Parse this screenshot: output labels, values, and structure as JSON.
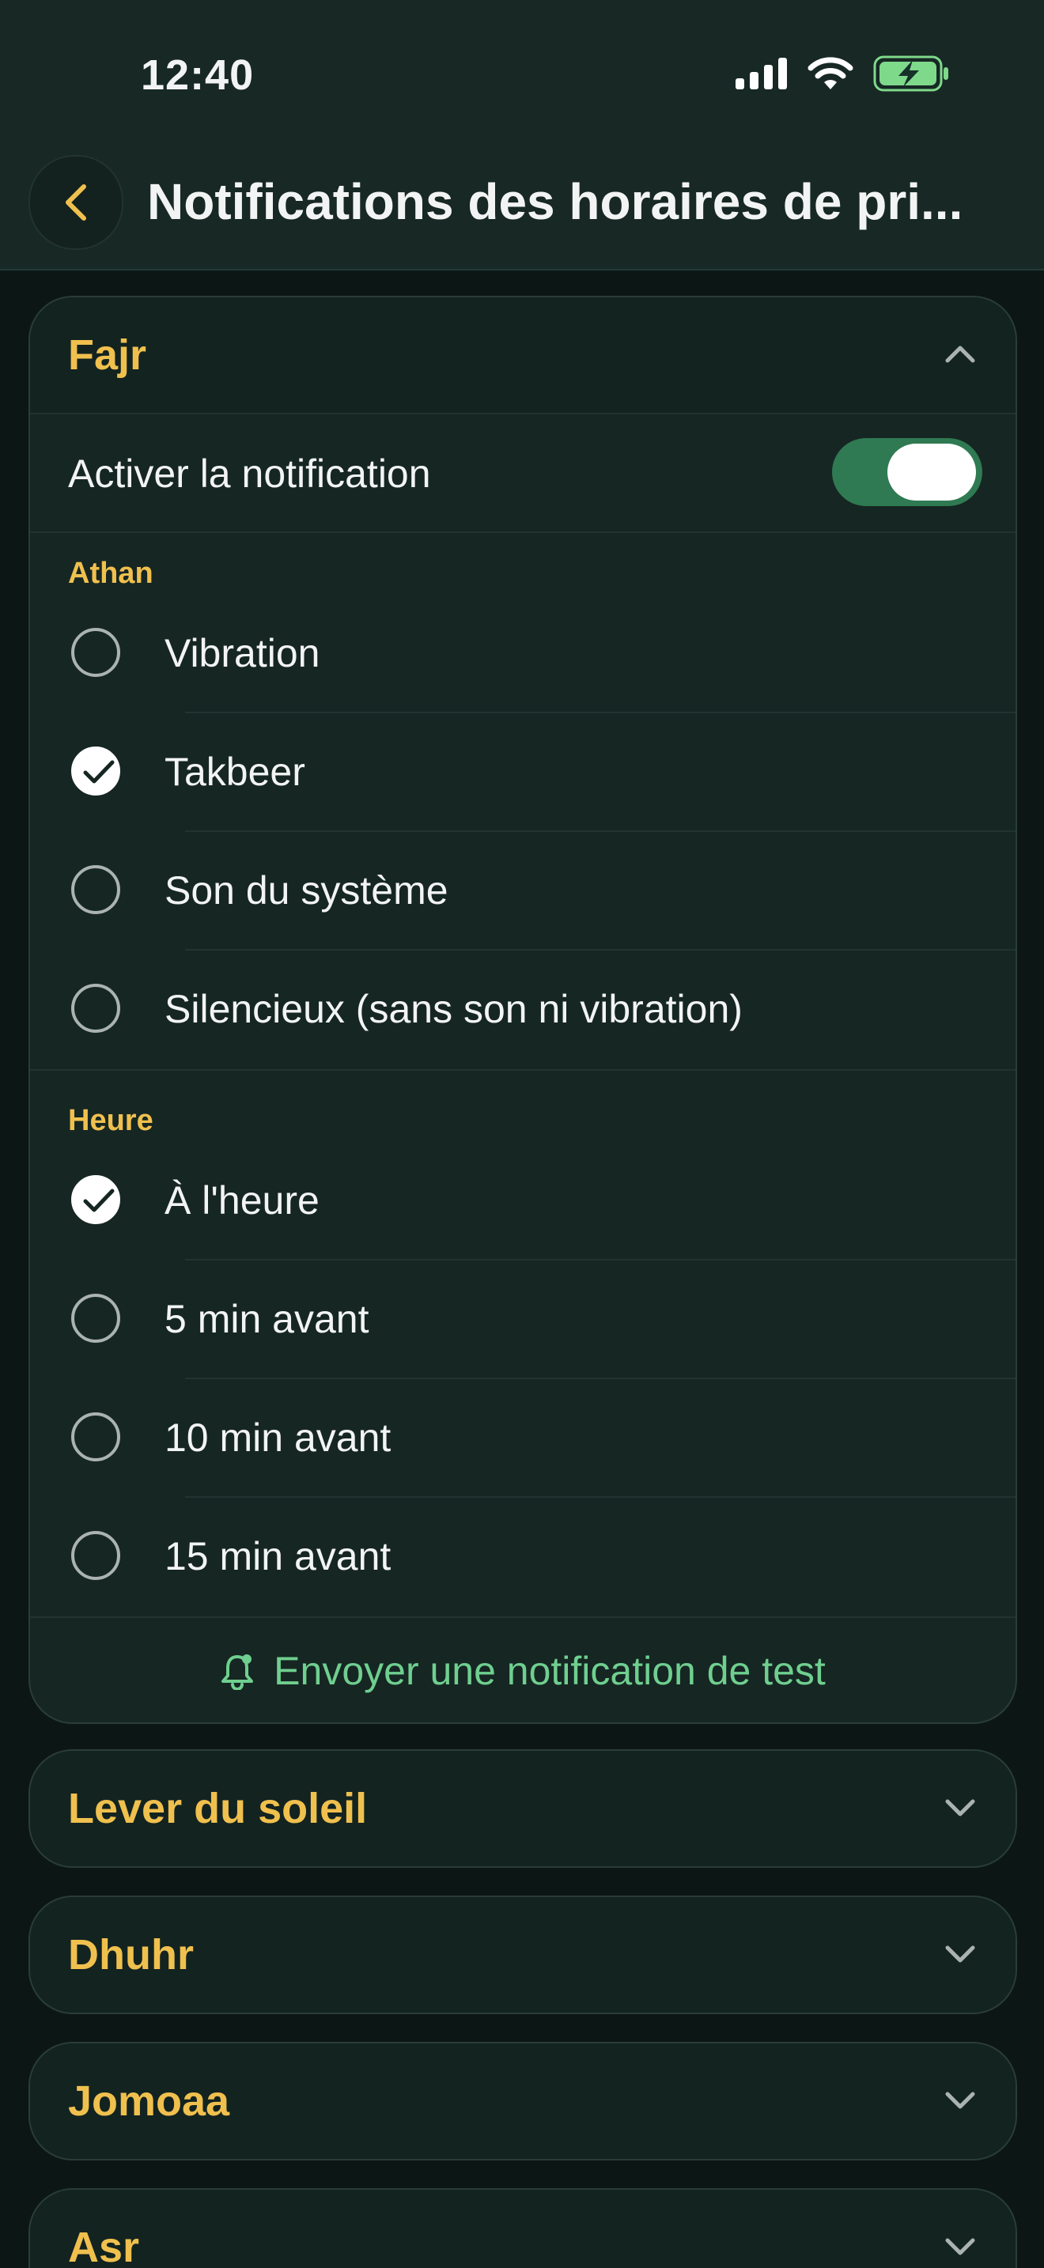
{
  "status_bar": {
    "time": "12:40"
  },
  "header": {
    "title": "Notifications des horaires de pri..."
  },
  "fajr": {
    "title": "Fajr",
    "enable_label": "Activer la notification",
    "enabled": true,
    "athan_label": "Athan",
    "athan_options": [
      "Vibration",
      "Takbeer",
      "Son du système",
      "Silencieux (sans son ni vibration)"
    ],
    "athan_selected": "Takbeer",
    "time_label": "Heure",
    "time_options": [
      "À l'heure",
      "5 min avant",
      "10 min avant",
      "15 min avant"
    ],
    "time_selected": "À l'heure",
    "test_label": "Envoyer une notification de test"
  },
  "collapsed_cards": [
    "Lever du soleil",
    "Dhuhr",
    "Jomoaa",
    "Asr"
  ],
  "colors": {
    "accent": "#f0c04e",
    "toggle_on": "#2f7a52",
    "test_link": "#6fcf8f",
    "background": "#0c1715"
  }
}
